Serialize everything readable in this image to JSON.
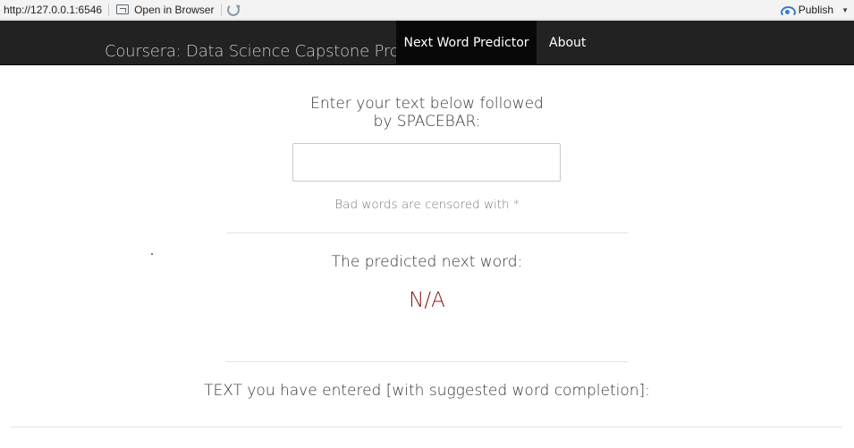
{
  "viewer": {
    "url": "http://127.0.0.1:6546",
    "open_in_browser": "Open in Browser",
    "publish": "Publish"
  },
  "navbar": {
    "brand": "Coursera: Data Science Capstone Project",
    "tabs": [
      {
        "label": "Next Word Predictor",
        "active": true
      },
      {
        "label": "About",
        "active": false
      }
    ]
  },
  "main": {
    "prompt": "Enter your text below followed by SPACEBAR:",
    "input_value": "",
    "censor_note": "Bad words are censored with *",
    "predicted_label": "The predicted next word:",
    "predicted_word": "N/A",
    "entered_label": "TEXT you have entered [with suggested word completion]:"
  },
  "colors": {
    "navbar_bg": "#222222",
    "active_tab_bg": "#080808",
    "prediction": "#8b1a1a"
  }
}
